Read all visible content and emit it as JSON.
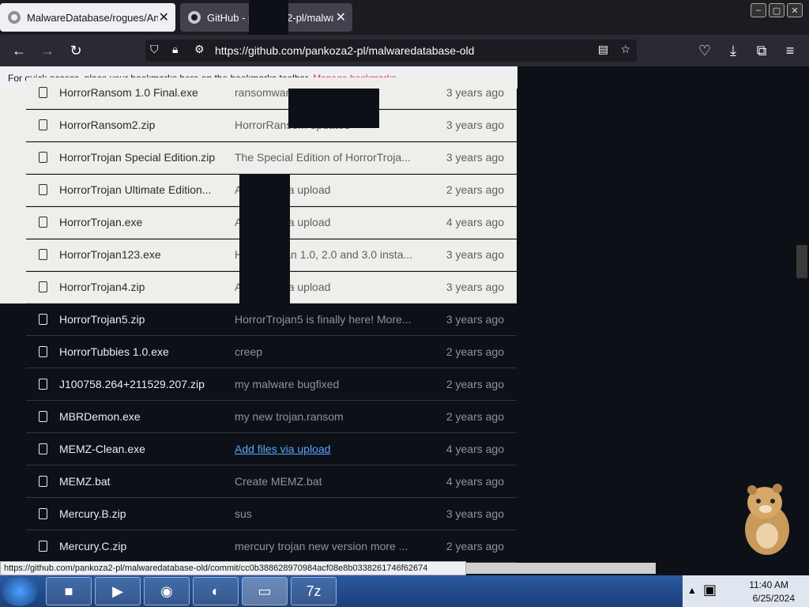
{
  "browser": {
    "tabs": [
      {
        "title": "MalwareDatabase/rogues/Anti",
        "active": false
      },
      {
        "title": "GitHub - pankoza2-pl/malwar",
        "active": true
      }
    ],
    "url": "https://github.com/pankoza2-pl/malwaredatabase-old",
    "bookmarks_hint": "For quick access, place your bookmarks here on the bookmarks toolbar.",
    "manage_bookmarks": "Manage bookmarks...",
    "status_url": "https://github.com/pankoza2-pl/malwaredatabase-old/commit/cc0b388628970984acf08e8b0338261746f62674"
  },
  "files": [
    {
      "name": "HorrorRansom 1.0 Final.exe",
      "commit": "ransomware destructive",
      "when": "3 years ago"
    },
    {
      "name": "HorrorRansom2.zip",
      "commit": "HorrorRansom updated",
      "when": "3 years ago"
    },
    {
      "name": "HorrorTrojan Special Edition.zip",
      "commit": "The Special Edition of HorrorTroja...",
      "when": "3 years ago"
    },
    {
      "name": "HorrorTrojan Ultimate Edition...",
      "commit": "Add files via upload",
      "when": "2 years ago"
    },
    {
      "name": "HorrorTrojan.exe",
      "commit": "Add files via upload",
      "when": "4 years ago"
    },
    {
      "name": "HorrorTrojan123.exe",
      "commit": "HorrorTrojan 1.0, 2.0 and 3.0 insta...",
      "when": "3 years ago"
    },
    {
      "name": "HorrorTrojan4.zip",
      "commit": "Add files via upload",
      "when": "3 years ago"
    },
    {
      "name": "HorrorTrojan5.zip",
      "commit": "HorrorTrojan5 is finally here! More...",
      "when": "3 years ago"
    },
    {
      "name": "HorrorTubbies 1.0.exe",
      "commit": "creep",
      "when": "2 years ago"
    },
    {
      "name": "J100758.264+211529.207.zip",
      "commit": "my malware bugfixed",
      "when": "2 years ago"
    },
    {
      "name": "MBRDemon.exe",
      "commit": "my new trojan.ransom",
      "when": "2 years ago"
    },
    {
      "name": "MEMZ-Clean.exe",
      "commit": "Add files via upload",
      "when": "4 years ago"
    },
    {
      "name": "MEMZ.bat",
      "commit": "Create MEMZ.bat",
      "when": "4 years ago"
    },
    {
      "name": "Mercury.B.zip",
      "commit": "sus",
      "when": "3 years ago"
    },
    {
      "name": "Mercury.C.zip",
      "commit": "mercury trojan new version more ...",
      "when": "2 years ago"
    }
  ],
  "taskbar": {
    "time": "11:40 AM",
    "date": "6/25/2024"
  },
  "icons": {
    "back": "back-arrow-icon",
    "forward": "forward-arrow-icon",
    "reload": "reload-icon",
    "file": "file-icon",
    "bookmark": "star-icon",
    "menu": "hamburger-menu-icon"
  }
}
